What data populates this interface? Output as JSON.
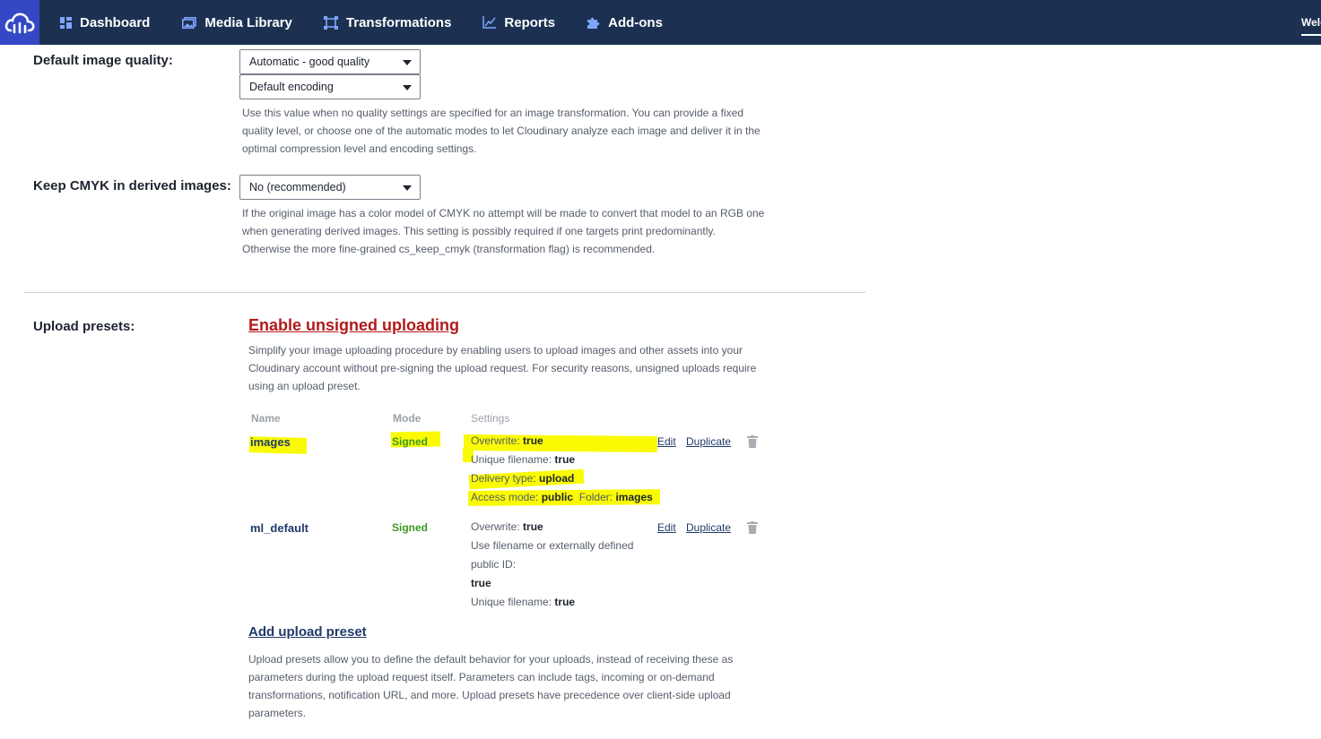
{
  "nav": {
    "items": [
      {
        "label": "Dashboard",
        "icon": "grid-icon"
      },
      {
        "label": "Media Library",
        "icon": "images-icon"
      },
      {
        "label": "Transformations",
        "icon": "transform-icon"
      },
      {
        "label": "Reports",
        "icon": "chart-icon"
      },
      {
        "label": "Add-ons",
        "icon": "puzzle-icon"
      }
    ],
    "right_text": "Welcome"
  },
  "quality": {
    "label": "Default image quality:",
    "select1": "Automatic - good quality",
    "select2": "Default encoding",
    "help": [
      "Use this value when no quality settings are specified for an image transformation. You can provide a fixed",
      "quality level, or choose one of the automatic modes to let Cloudinary analyze each image and deliver it in the",
      "optimal compression level and encoding settings."
    ]
  },
  "cmyk": {
    "label": "Keep CMYK in derived images:",
    "select": "No (recommended)",
    "help": [
      "If the original image has a color model of CMYK no attempt will be made to convert that model to an RGB one",
      "when generating derived images. This setting is possibly required if one targets print predominantly.",
      "Otherwise the more fine-grained cs_keep_cmyk (transformation flag) is recommended."
    ]
  },
  "upload": {
    "label": "Upload presets:",
    "enable_link": "Enable unsigned uploading",
    "enable_help": [
      "Simplify your image uploading procedure by enabling users to upload images and other assets into your",
      "Cloudinary account without pre-signing the upload request. For security reasons, unsigned uploads require",
      "using an upload preset."
    ],
    "columns": {
      "name": "Name",
      "mode": "Mode",
      "settings": "Settings"
    },
    "actions": {
      "edit": "Edit",
      "duplicate": "Duplicate"
    },
    "presets": [
      {
        "name": "images",
        "mode": "Signed",
        "s": {
          "overwrite_k": "Overwrite:",
          "overwrite_v": "true",
          "unique_k": "Unique filename:",
          "unique_v": "true",
          "delivery_k": "Delivery type:",
          "delivery_v": "upload",
          "access_k": "Access mode:",
          "access_v": "public",
          "folder_k": "Folder:",
          "folder_v": "images"
        }
      },
      {
        "name": "ml_default",
        "mode": "Signed",
        "s": {
          "overwrite_k": "Overwrite:",
          "overwrite_v": "true",
          "usefn_l1": "Use filename or externally defined",
          "usefn_l2": "public ID:",
          "usefn_v": "true",
          "unique_k": "Unique filename:",
          "unique_v": "true"
        }
      }
    ],
    "add_link": "Add upload preset",
    "add_help": [
      "Upload presets allow you to define the default behavior for your uploads, instead of receiving these as",
      "parameters during the upload request itself. Parameters can include tags, incoming or on-demand",
      "transformations, notification URL, and more. Upload presets have precedence over client-side upload",
      "parameters."
    ]
  },
  "colors": {
    "nav_bg": "#1c3152",
    "logo_bg": "#3448c5",
    "link_red": "#b11a1a",
    "signed_green": "#3c9a25",
    "highlight": "#fafa05"
  }
}
